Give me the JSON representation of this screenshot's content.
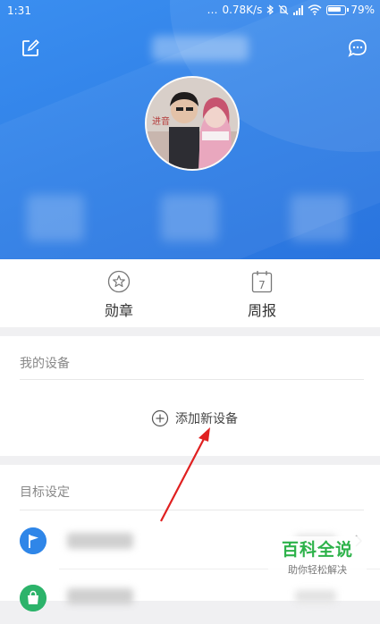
{
  "status_bar": {
    "time": "1:31",
    "dots": "…",
    "speed": "0.78K/s",
    "battery_percent": "79%",
    "icons": [
      "bluetooth-icon",
      "mute-icon",
      "signal-icon",
      "wifi-icon",
      "battery-icon"
    ]
  },
  "header": {
    "edit_icon": "edit-icon",
    "message_icon": "message-icon",
    "colors": {
      "gradient_start": "#3a8ef0",
      "gradient_end": "#2a74de"
    }
  },
  "quick_actions": [
    {
      "label": "勋章",
      "icon": "star-medal-icon"
    },
    {
      "label": "周报",
      "icon": "calendar-icon",
      "icon_text": "7"
    }
  ],
  "devices": {
    "title": "我的设备",
    "add_label": "添加新设备"
  },
  "goals": {
    "title": "目标设定",
    "row_icons": [
      "flag-icon",
      "bag-icon"
    ],
    "row_colors": [
      "#2f86e8",
      "#2cb36a"
    ]
  },
  "watermark": {
    "title": "百科全说",
    "subtitle": "助你轻松解决",
    "color": "#2db24a"
  },
  "annotation": {
    "arrow_color": "#e02020"
  }
}
